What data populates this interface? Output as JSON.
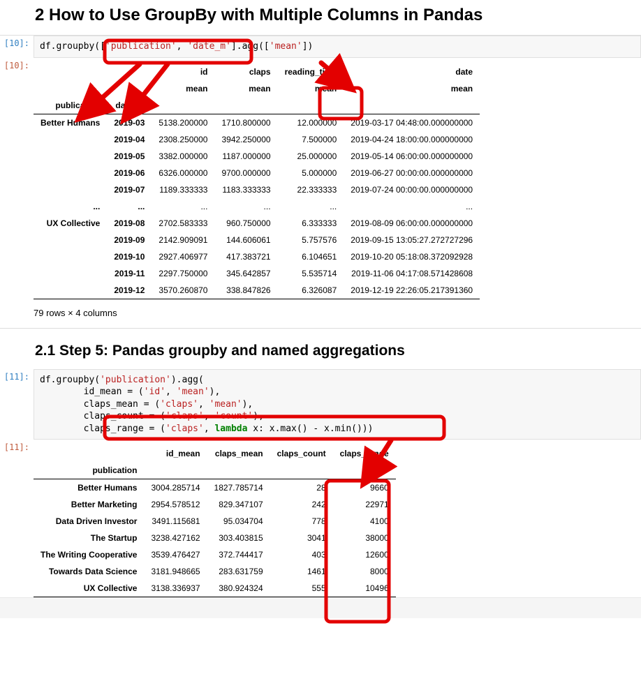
{
  "section2": {
    "heading": "2  How to Use GroupBy with Multiple Columns in Pandas",
    "in_prompt": "[10]:",
    "out_prompt": "[10]:",
    "code_pre": "df.groupby(",
    "code_arg1": "'publication'",
    "code_arg2": "'date_m'",
    "code_mid": ".agg([",
    "code_arg3": "'mean'",
    "code_end": "])",
    "top_headers": [
      "id",
      "claps",
      "reading_time",
      "date"
    ],
    "sub_header": "mean",
    "index_names": [
      "publication",
      "date_m"
    ],
    "rows_top": [
      {
        "pub": "Better Humans",
        "dm": "2019-03",
        "id": "5138.200000",
        "claps": "1710.800000",
        "rt": "12.000000",
        "date": "2019-03-17 04:48:00.000000000"
      },
      {
        "pub": "",
        "dm": "2019-04",
        "id": "2308.250000",
        "claps": "3942.250000",
        "rt": "7.500000",
        "date": "2019-04-24 18:00:00.000000000"
      },
      {
        "pub": "",
        "dm": "2019-05",
        "id": "3382.000000",
        "claps": "1187.000000",
        "rt": "25.000000",
        "date": "2019-05-14 06:00:00.000000000"
      },
      {
        "pub": "",
        "dm": "2019-06",
        "id": "6326.000000",
        "claps": "9700.000000",
        "rt": "5.000000",
        "date": "2019-06-27 00:00:00.000000000"
      },
      {
        "pub": "",
        "dm": "2019-07",
        "id": "1189.333333",
        "claps": "1183.333333",
        "rt": "22.333333",
        "date": "2019-07-24 00:00:00.000000000"
      }
    ],
    "ellipsis": "...",
    "rows_bot": [
      {
        "pub": "UX Collective",
        "dm": "2019-08",
        "id": "2702.583333",
        "claps": "960.750000",
        "rt": "6.333333",
        "date": "2019-08-09 06:00:00.000000000"
      },
      {
        "pub": "",
        "dm": "2019-09",
        "id": "2142.909091",
        "claps": "144.606061",
        "rt": "5.757576",
        "date": "2019-09-15 13:05:27.272727296"
      },
      {
        "pub": "",
        "dm": "2019-10",
        "id": "2927.406977",
        "claps": "417.383721",
        "rt": "6.104651",
        "date": "2019-10-20 05:18:08.372092928"
      },
      {
        "pub": "",
        "dm": "2019-11",
        "id": "2297.750000",
        "claps": "345.642857",
        "rt": "5.535714",
        "date": "2019-11-06 04:17:08.571428608"
      },
      {
        "pub": "",
        "dm": "2019-12",
        "id": "3570.260870",
        "claps": "338.847826",
        "rt": "6.326087",
        "date": "2019-12-19 22:26:05.217391360"
      }
    ],
    "footer": "79 rows × 4 columns"
  },
  "section21": {
    "heading": "2.1  Step 5: Pandas groupby and named aggregations",
    "in_prompt": "[11]:",
    "out_prompt": "[11]:",
    "code": {
      "l1a": "df.groupby(",
      "l1b": "'publication'",
      "l1c": ").agg(",
      "l2a": "        id_mean = (",
      "l2b": "'id'",
      "l2c": ", ",
      "l2d": "'mean'",
      "l2e": "),",
      "l3a": "        claps_mean = (",
      "l3b": "'claps'",
      "l3c": ", ",
      "l3d": "'mean'",
      "l3e": "),",
      "l4a": "        claps_count = (",
      "l4b": "'claps'",
      "l4c": ", ",
      "l4d": "'count'",
      "l4e": "),",
      "l5a": "        claps_range = (",
      "l5b": "'claps'",
      "l5c": ", ",
      "l5kw": "lambda",
      "l5d": " x: x.max() - x.min()))"
    },
    "headers": [
      "id_mean",
      "claps_mean",
      "claps_count",
      "claps_range"
    ],
    "index_name": "publication",
    "rows": [
      {
        "pub": "Better Humans",
        "id": "3004.285714",
        "cm": "1827.785714",
        "cc": "28",
        "cr": "9660"
      },
      {
        "pub": "Better Marketing",
        "id": "2954.578512",
        "cm": "829.347107",
        "cc": "242",
        "cr": "22971"
      },
      {
        "pub": "Data Driven Investor",
        "id": "3491.115681",
        "cm": "95.034704",
        "cc": "778",
        "cr": "4100"
      },
      {
        "pub": "The Startup",
        "id": "3238.427162",
        "cm": "303.403815",
        "cc": "3041",
        "cr": "38000"
      },
      {
        "pub": "The Writing Cooperative",
        "id": "3539.476427",
        "cm": "372.744417",
        "cc": "403",
        "cr": "12600"
      },
      {
        "pub": "Towards Data Science",
        "id": "3181.948665",
        "cm": "283.631759",
        "cc": "1461",
        "cr": "8000"
      },
      {
        "pub": "UX Collective",
        "id": "3138.336937",
        "cm": "380.924324",
        "cc": "555",
        "cr": "10496"
      }
    ]
  }
}
